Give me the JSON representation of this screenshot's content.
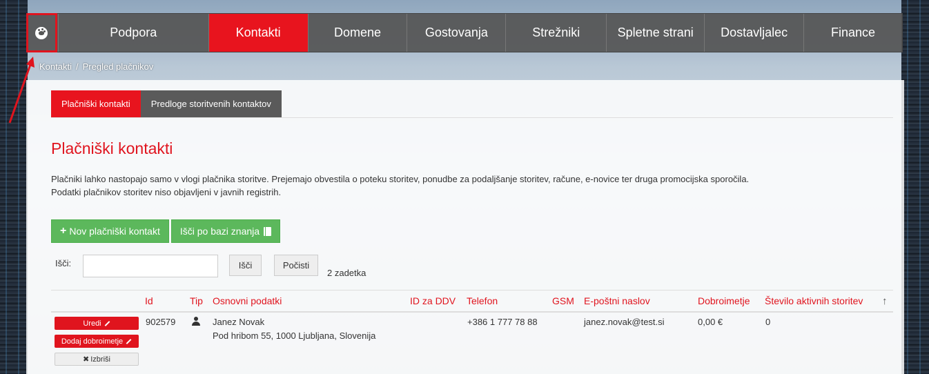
{
  "nav": {
    "items": [
      {
        "label": "Podpora",
        "active": false
      },
      {
        "label": "Kontakti",
        "active": true
      },
      {
        "label": "Domene",
        "active": false
      },
      {
        "label": "Gostovanja",
        "active": false
      },
      {
        "label": "Strežniki",
        "active": false
      },
      {
        "label": "Spletne strani",
        "active": false
      },
      {
        "label": "Dostavljalec",
        "active": false
      },
      {
        "label": "Finance",
        "active": false
      }
    ]
  },
  "breadcrumb": {
    "root": "Kontakti",
    "separator": "/",
    "current": "Pregled plačnikov"
  },
  "tabs": [
    {
      "label": "Plačniški kontakti",
      "active": true
    },
    {
      "label": "Predloge storitvenih kontaktov",
      "active": false
    }
  ],
  "page": {
    "title": "Plačniški kontakti",
    "description_line1": "Plačniki lahko nastopajo samo v vlogi plačnika storitve. Prejemajo obvestila o poteku storitev, ponudbe za podaljšanje storitev, račune, e-novice ter druga promocijska sporočila.",
    "description_line2": "Podatki plačnikov storitev niso objavljeni v javnih registrih."
  },
  "actions": {
    "new_contact": "Nov plačniški kontakt",
    "search_kb": "Išči po bazi znanja"
  },
  "search": {
    "label": "Išči:",
    "value": "",
    "search_button": "Išči",
    "clear_button": "Počisti",
    "hits": "2 zadetka"
  },
  "table": {
    "headers": [
      "Id",
      "Tip",
      "Osnovni podatki",
      "ID za DDV",
      "Telefon",
      "GSM",
      "E-poštni naslov",
      "Dobroimetje",
      "Število aktivnih storitev"
    ],
    "rows": [
      {
        "id": "902579",
        "name": "Janez Novak",
        "address": "Pod hribom 55, 1000 Ljubljana, Slovenija",
        "vat": "",
        "phone": "+386 1 777 78 88",
        "gsm": "",
        "email": "janez.novak@test.si",
        "credit": "0,00 €",
        "active_services": "0",
        "buttons": {
          "edit": "Uredi",
          "add_credit": "Dodaj dobroimetje",
          "delete": "Izbriši"
        }
      }
    ]
  },
  "colors": {
    "accent": "#e8141e",
    "nav_bg": "#555555",
    "green": "#5cb85c"
  }
}
